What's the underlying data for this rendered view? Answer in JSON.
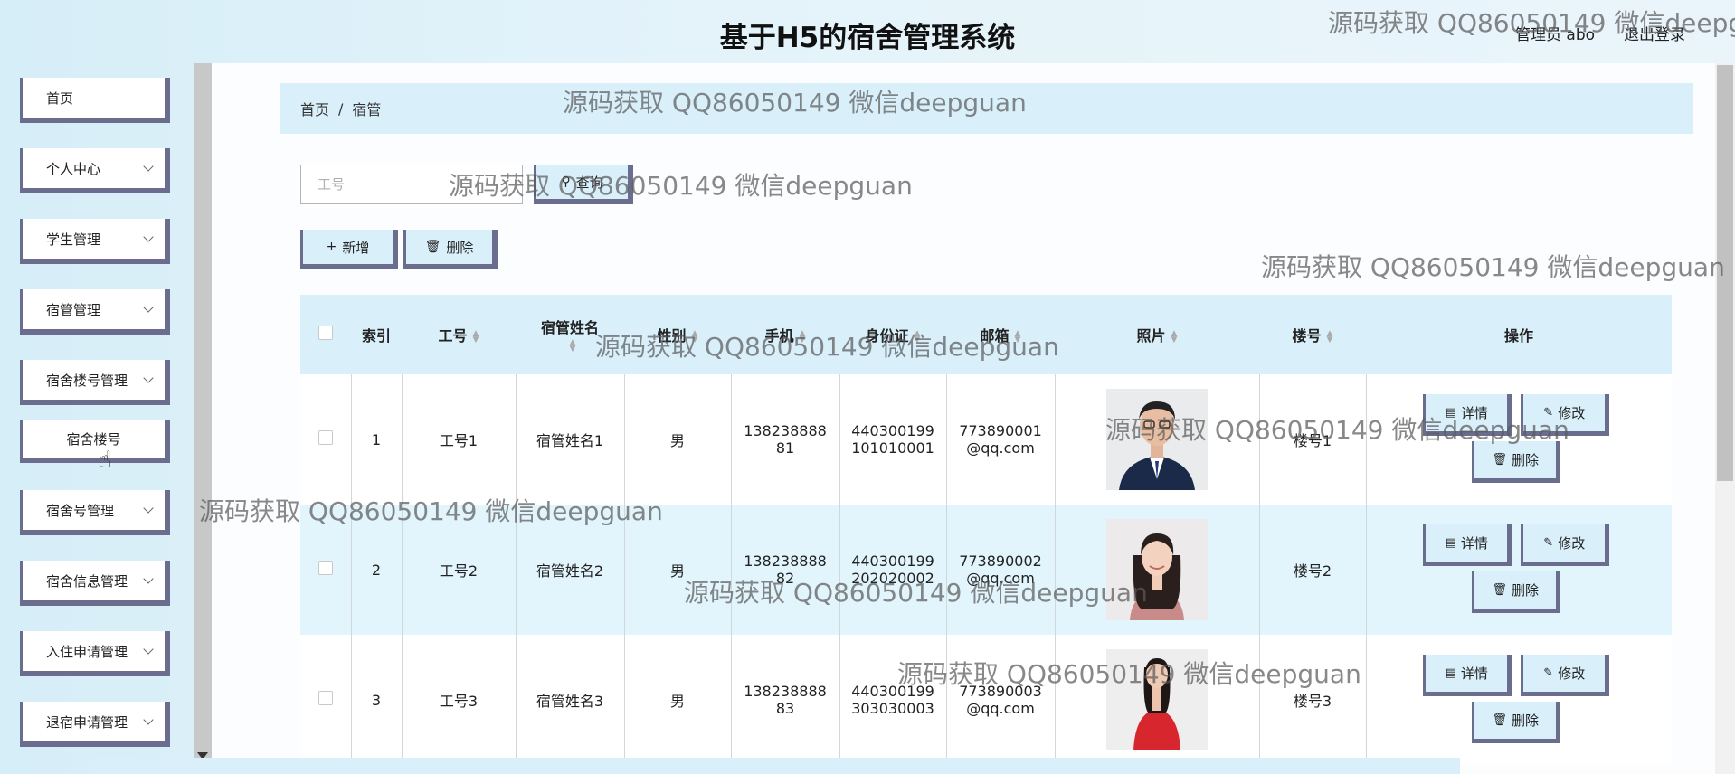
{
  "header": {
    "title": "基于H5的宿舍管理系统",
    "user_label": "管理员 abo",
    "logout_label": "退出登录"
  },
  "sidebar": {
    "items": [
      {
        "label": "首页"
      },
      {
        "label": "个人中心"
      },
      {
        "label": "学生管理"
      },
      {
        "label": "宿管管理"
      },
      {
        "label": "宿舍楼号管理"
      },
      {
        "label": "宿舍楼号"
      },
      {
        "label": "宿舍号管理"
      },
      {
        "label": "宿舍信息管理"
      },
      {
        "label": "入住申请管理"
      },
      {
        "label": "退宿申请管理"
      }
    ]
  },
  "breadcrumb": {
    "home": "首页",
    "sep": "/",
    "current": "宿管"
  },
  "search": {
    "placeholder": "工号",
    "button_label": "查询"
  },
  "toolbar": {
    "add_label": "新增",
    "delete_label": "删除"
  },
  "table": {
    "headers": [
      "索引",
      "工号",
      "宿管姓名",
      "性别",
      "手机",
      "身份证",
      "邮箱",
      "照片",
      "楼号",
      "操作"
    ],
    "rows": [
      {
        "index": "1",
        "id": "工号1",
        "name": "宿管姓名1",
        "gender": "男",
        "phone_1": "138238888",
        "phone_2": "81",
        "idcard_1": "440300199",
        "idcard_2": "101010001",
        "email_1": "773890001",
        "email_2": "@qq.com",
        "building": "楼号1"
      },
      {
        "index": "2",
        "id": "工号2",
        "name": "宿管姓名2",
        "gender": "男",
        "phone_1": "138238888",
        "phone_2": "82",
        "idcard_1": "440300199",
        "idcard_2": "202020002",
        "email_1": "773890002",
        "email_2": "@qq.com",
        "building": "楼号2"
      },
      {
        "index": "3",
        "id": "工号3",
        "name": "宿管姓名3",
        "gender": "男",
        "phone_1": "138238888",
        "phone_2": "83",
        "idcard_1": "440300199",
        "idcard_2": "303030003",
        "email_1": "773890003",
        "email_2": "@qq.com",
        "building": "楼号3"
      }
    ],
    "actions": {
      "detail": "详情",
      "edit": "修改",
      "delete": "删除"
    }
  },
  "watermark": "源码获取 QQ86050149 微信deepguan",
  "colors": {
    "accent": "#d9f0fb",
    "button_border": "#6a6d8e"
  }
}
